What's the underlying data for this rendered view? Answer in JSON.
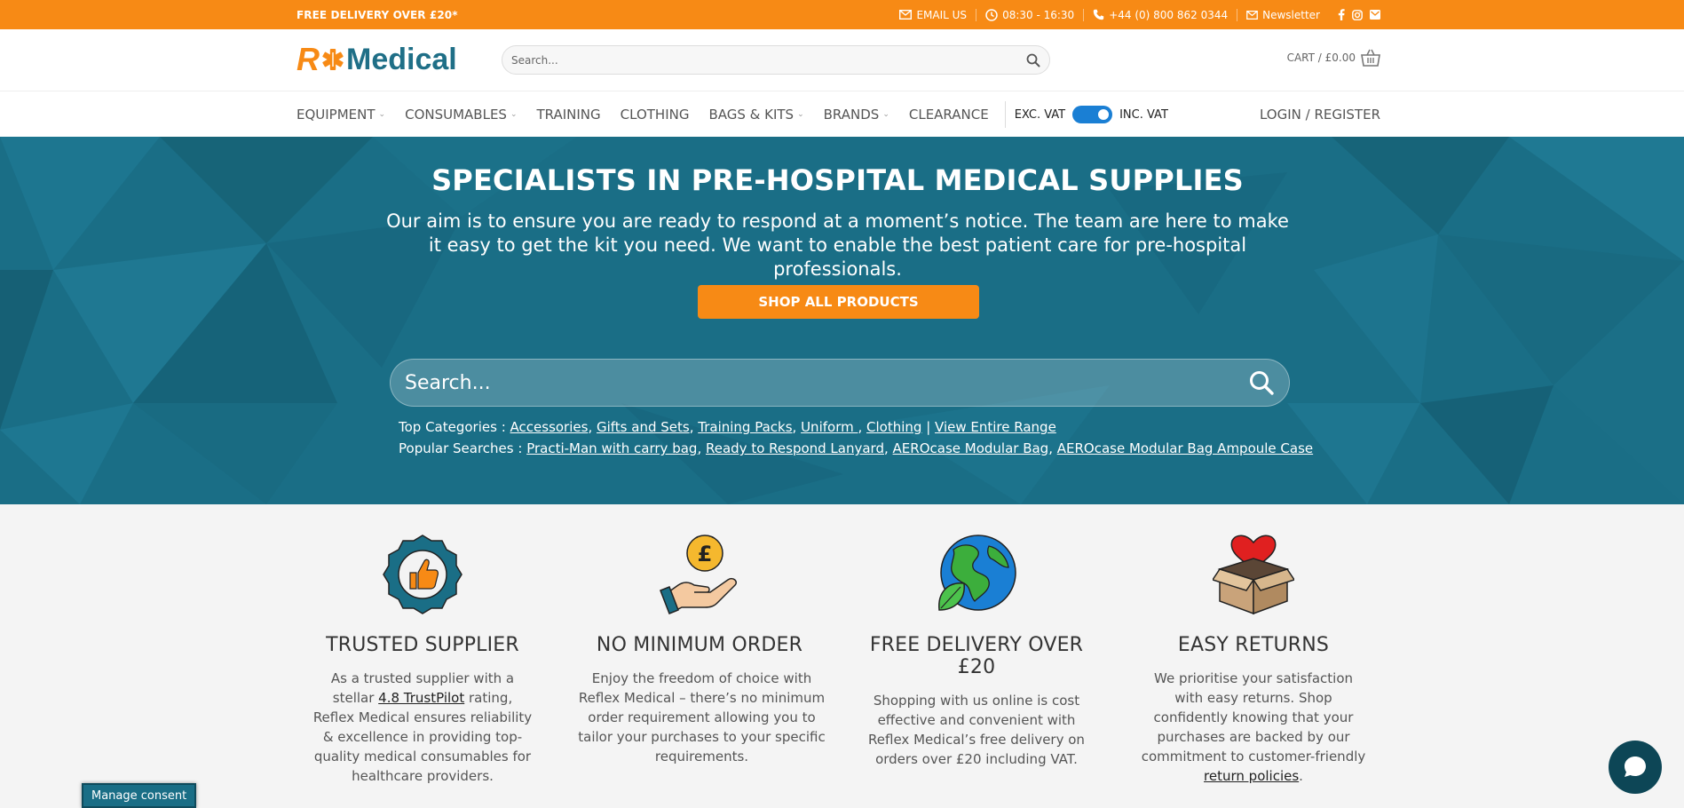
{
  "topbar": {
    "promo": "FREE DELIVERY OVER £20*",
    "email": "EMAIL US",
    "hours": "08:30 - 16:30",
    "phone": "+44 (0) 800 862 0344",
    "newsletter": "Newsletter"
  },
  "header": {
    "logo_r": "R",
    "logo_text": "Medical",
    "search_placeholder": "Search...",
    "cart": "CART / £0.00"
  },
  "nav": {
    "items": [
      {
        "label": "EQUIPMENT",
        "dropdown": true
      },
      {
        "label": "CONSUMABLES",
        "dropdown": true
      },
      {
        "label": "TRAINING",
        "dropdown": false
      },
      {
        "label": "CLOTHING",
        "dropdown": false
      },
      {
        "label": "BAGS & KITS",
        "dropdown": true
      },
      {
        "label": "BRANDS",
        "dropdown": true
      },
      {
        "label": "CLEARANCE",
        "dropdown": false
      }
    ],
    "vat_exc": "EXC. VAT",
    "vat_inc": "INC. VAT",
    "login": "LOGIN / REGISTER"
  },
  "hero": {
    "title": "SPECIALISTS IN PRE-HOSPITAL MEDICAL SUPPLIES",
    "lead": "Our aim is to ensure you are ready to respond at a moment’s notice. The team are here to make it easy to get the kit you need. We want to enable the best patient care for pre-hospital professionals.",
    "button": "SHOP ALL PRODUCTS",
    "search_placeholder": "Search...",
    "top_categories_label": "Top Categories : ",
    "top_categories": [
      "Accessories",
      "Gifts and Sets",
      "Training Packs",
      "Uniform ",
      "Clothing"
    ],
    "view_range": "View Entire Range",
    "popular_label": "Popular Searches : ",
    "popular": [
      "Practi-Man with carry bag",
      "Ready to Respond Lanyard",
      "AEROcase Modular Bag",
      "AEROcase Modular Bag Ampoule Case"
    ]
  },
  "features": [
    {
      "title": "TRUSTED SUPPLIER",
      "text_before": "As a trusted supplier with a stellar ",
      "link": "4.8 TrustPilot",
      "text_after": " rating, Reflex Medical ensures reliability & excellence in providing top-quality medical consumables for healthcare providers."
    },
    {
      "title": "NO MINIMUM ORDER",
      "text_before": "Enjoy the freedom of choice with Reflex Medical – there’s no minimum order requirement allowing you to tailor your purchases to your specific requirements.",
      "link": "",
      "text_after": ""
    },
    {
      "title": "FREE DELIVERY OVER £20",
      "text_before": "Shopping with us online is cost effective and convenient with Reflex Medical’s free delivery on orders over £20 including VAT.",
      "link": "",
      "text_after": ""
    },
    {
      "title": "EASY RETURNS",
      "text_before": "We prioritise your satisfaction with easy returns. Shop confidently knowing that your purchases are backed by our commitment to customer-friendly ",
      "link": "return policies",
      "text_after": "."
    }
  ],
  "consent": "Manage consent",
  "colors": {
    "orange": "#f78a15",
    "teal": "#1a6e86",
    "toggle": "#1a7fd4"
  }
}
